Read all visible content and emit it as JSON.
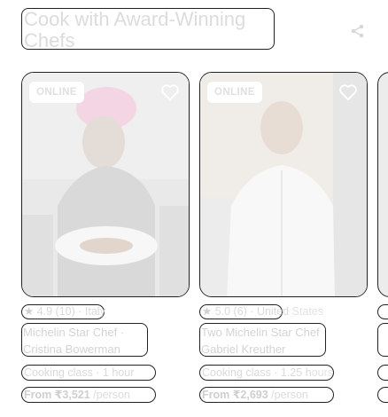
{
  "section": {
    "title": "Cook with Award-Winning Chefs"
  },
  "icons": {
    "share": "share-icon",
    "favorite": "heart-outline-icon"
  },
  "colors": {
    "outline": "#222222",
    "faded_text": "#d8d8d8",
    "badge_bg": "#ffffff"
  },
  "cards": [
    {
      "badge": "ONLINE",
      "rating_star": "★",
      "rating": "4.9 (10) · Italy",
      "title": "Michelin Star Chef · Cristina Bowerman",
      "title_line1": "Michelin Star Chef ·",
      "title_line2": "Cristina Bowerman",
      "meta": "Cooking class · 1 hour",
      "price_amount": "From ₹3,521",
      "price_unit": " /person"
    },
    {
      "badge": "ONLINE",
      "rating_star": "★",
      "rating": "5.0 (6) · United States",
      "rating_main": "5.0 (6) · United",
      "rating_rest": " States",
      "title": "Two Michelin Star Chef Gabriel Kreuther",
      "title_line1": "Two Michelin Star Chef",
      "title_line2": "Gabriel Kreuther",
      "meta": "Cooking class · 1.25 hours",
      "meta_main": "Cooking class · 1.25 h",
      "meta_rest": "ours",
      "price_amount": "From ₹2,693",
      "price_unit": " /person"
    }
  ]
}
